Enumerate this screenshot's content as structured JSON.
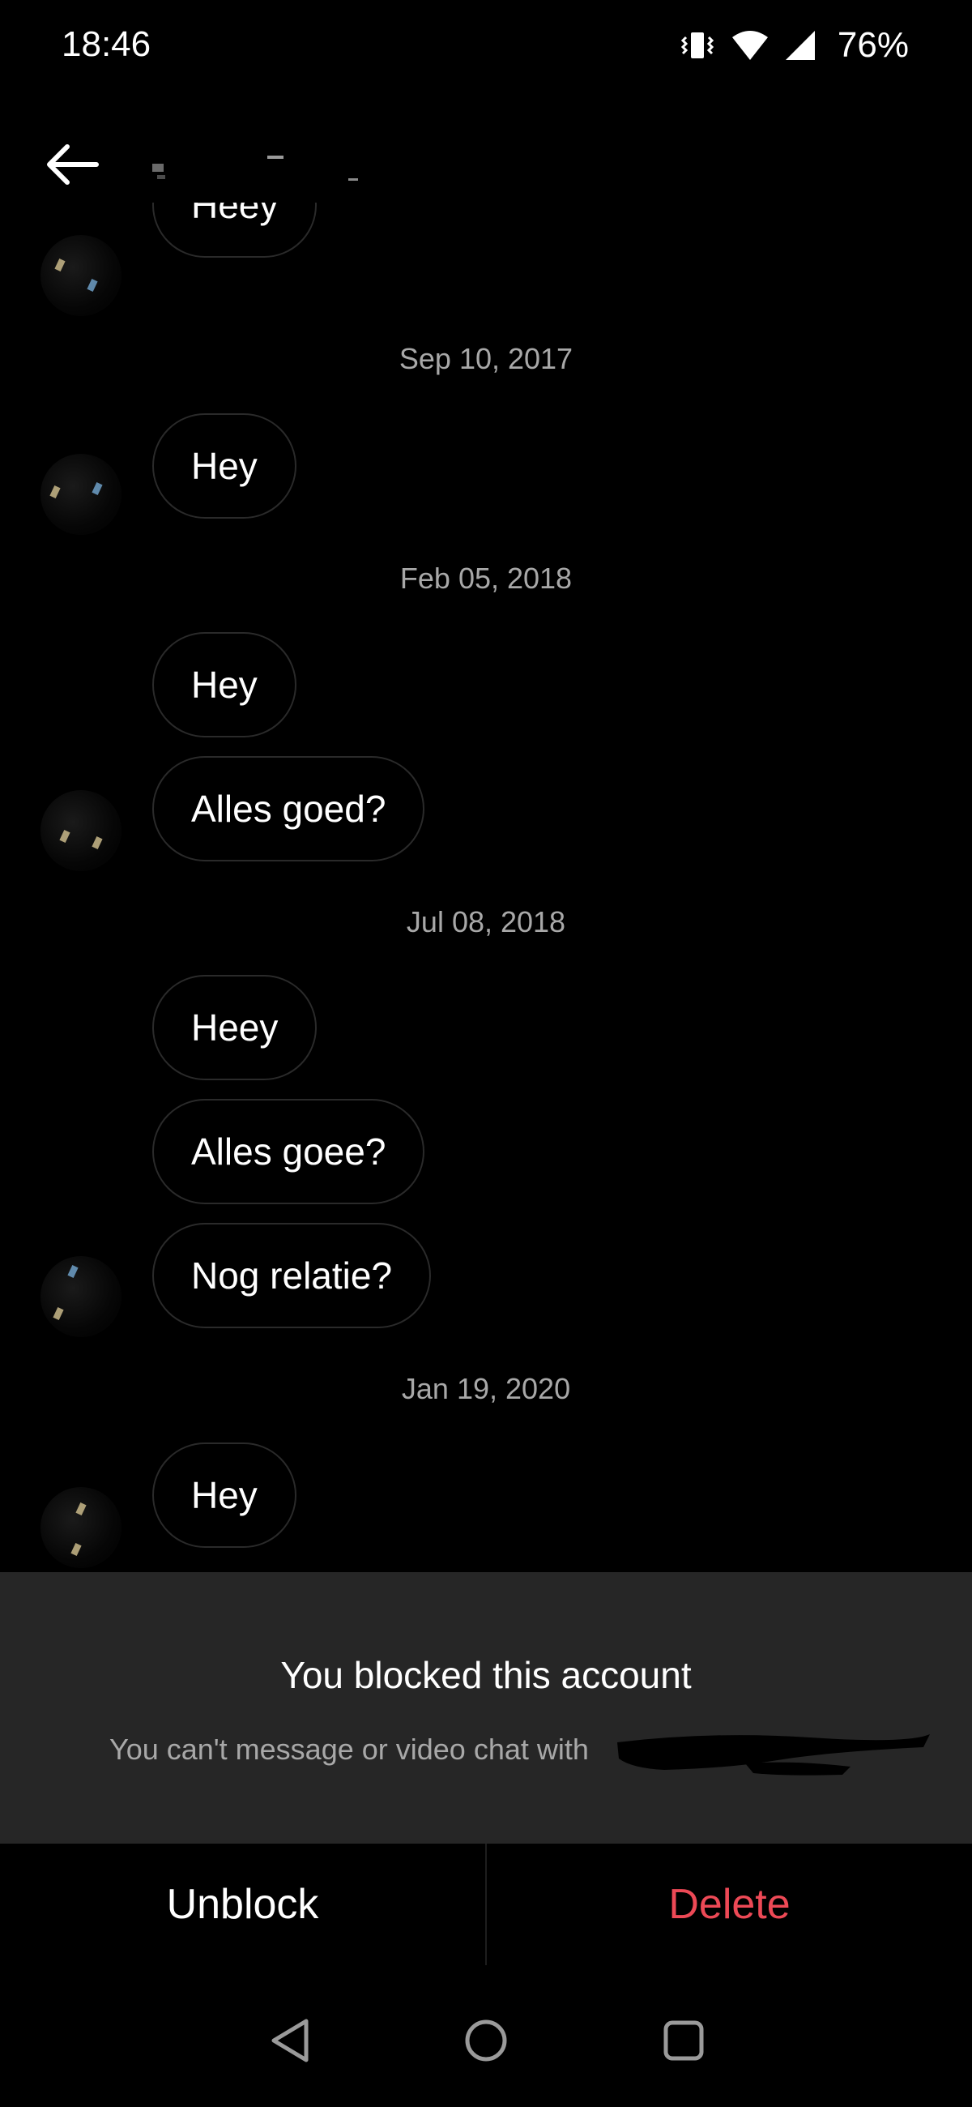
{
  "status_bar": {
    "time": "18:46",
    "battery": "76%",
    "icons": [
      "vibrate-icon",
      "wifi-icon",
      "signal-icon"
    ]
  },
  "header": {
    "back_icon": "arrow-left-icon",
    "contact_name": "redacted"
  },
  "messages": [
    {
      "type": "bubble",
      "text": "Heey",
      "avatar": true
    },
    {
      "type": "date",
      "text": "Sep 10, 2017"
    },
    {
      "type": "bubble",
      "text": "Hey",
      "avatar": true
    },
    {
      "type": "date",
      "text": "Feb 05, 2018"
    },
    {
      "type": "bubble",
      "text": "Hey",
      "avatar": false
    },
    {
      "type": "bubble",
      "text": "Alles goed?",
      "avatar": true
    },
    {
      "type": "date",
      "text": "Jul 08, 2018"
    },
    {
      "type": "bubble",
      "text": "Heey",
      "avatar": false
    },
    {
      "type": "bubble",
      "text": "Alles goee?",
      "avatar": false
    },
    {
      "type": "bubble",
      "text": "Nog relatie?",
      "avatar": true
    },
    {
      "type": "date",
      "text": "Jan 19, 2020"
    },
    {
      "type": "bubble",
      "text": "Hey",
      "avatar": true
    }
  ],
  "blocked": {
    "title": "You blocked this account",
    "subtitle": "You can't message or video chat with"
  },
  "actions": {
    "unblock_label": "Unblock",
    "delete_label": "Delete",
    "delete_color": "#ed4956"
  },
  "nav": {
    "back_icon": "nav-back-icon",
    "home_icon": "nav-home-icon",
    "recents_icon": "nav-recents-icon"
  },
  "colors": {
    "background": "#000000",
    "panel": "#262626",
    "secondary_text": "#a8a8a8",
    "bubble_border": "#2a2a2a"
  }
}
